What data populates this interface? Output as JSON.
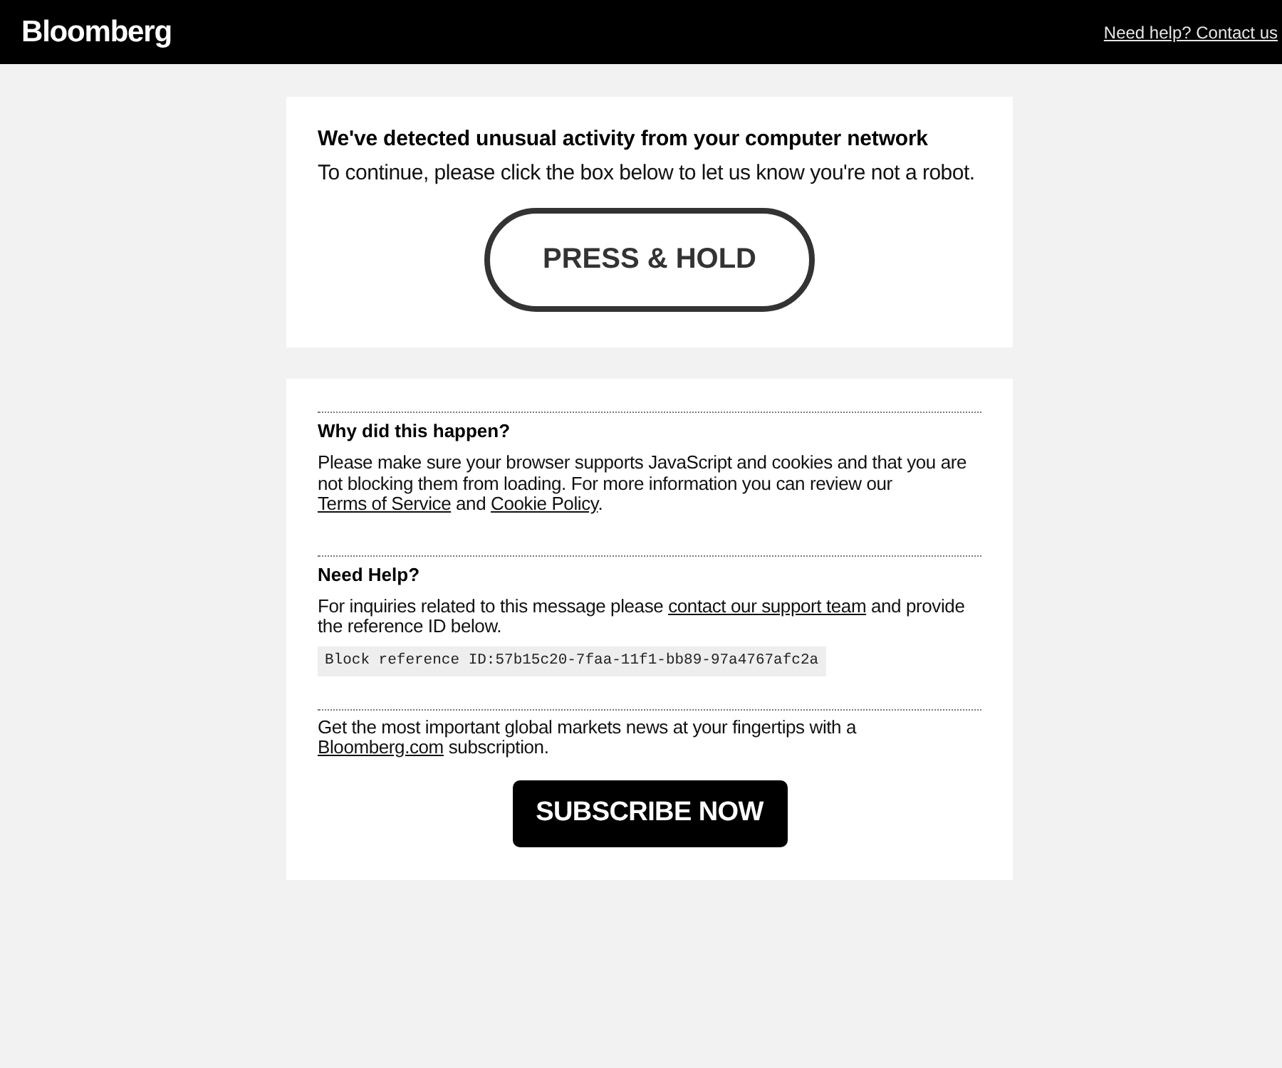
{
  "header": {
    "logo": "Bloomberg",
    "help_link": "Need help? Contact us"
  },
  "challenge": {
    "title": "We've detected unusual activity from your computer network",
    "message": "To continue, please click the box below to let us know you're not a robot.",
    "button": "PRESS & HOLD"
  },
  "info": {
    "sections": [
      {
        "heading": "Why did this happen?",
        "paragraph": [
          {
            "kind": "text",
            "text": "Please make sure your browser supports JavaScript and cookies and that you are not blocking them from loading. For more information you can review our "
          },
          {
            "kind": "link",
            "text": "Terms of Service"
          },
          {
            "kind": "text",
            "text": " and "
          },
          {
            "kind": "link",
            "text": "Cookie Policy"
          },
          {
            "kind": "text",
            "text": "."
          }
        ]
      },
      {
        "heading": "Need Help?",
        "paragraph": [
          {
            "kind": "text",
            "text": "For inquiries related to this message please "
          },
          {
            "kind": "link",
            "text": "contact our support team"
          },
          {
            "kind": "text",
            "text": " and provide the reference ID below."
          }
        ],
        "reference": "Block reference ID:57b15c20-7faa-11f1-bb89-97a4767afc2a"
      },
      {
        "paragraph": [
          {
            "kind": "text",
            "text": "Get the most important global markets news at your fingertips with a "
          },
          {
            "kind": "link",
            "text": "Bloomberg.com"
          },
          {
            "kind": "text",
            "text": " subscription."
          }
        ]
      }
    ],
    "button": "SUBSCRIBE NOW"
  }
}
